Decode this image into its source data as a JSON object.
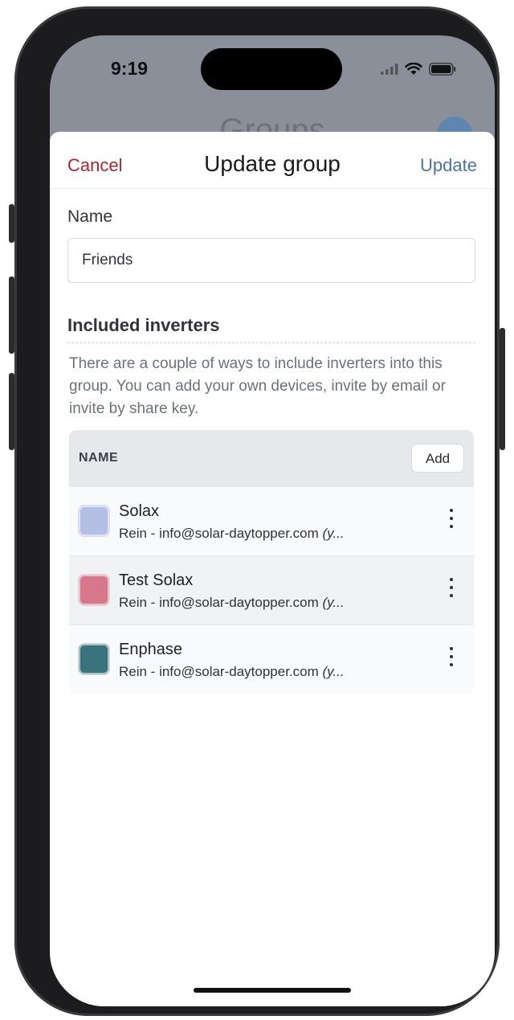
{
  "status": {
    "time": "9:19"
  },
  "background": {
    "title": "Groups"
  },
  "nav": {
    "cancel": "Cancel",
    "title": "Update group",
    "update": "Update"
  },
  "form": {
    "name_label": "Name",
    "name_value": "Friends"
  },
  "inverters": {
    "title": "Included inverters",
    "description": "There are a couple of ways to include inverters into this group. You can add your own devices, invite by email or invite by share key.",
    "column_header": "NAME",
    "add_label": "Add",
    "rows": [
      {
        "name": "Solax",
        "owner": "Rein - info@solar-daytopper.com",
        "suffix": "(y...",
        "color": "#b4bfe6"
      },
      {
        "name": "Test Solax",
        "owner": "Rein - info@solar-daytopper.com",
        "suffix": "(y...",
        "color": "#d6778c"
      },
      {
        "name": "Enphase",
        "owner": "Rein - info@solar-daytopper.com",
        "suffix": "(y...",
        "color": "#3a737b"
      }
    ]
  }
}
